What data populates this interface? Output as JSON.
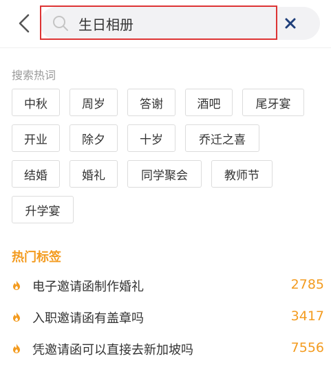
{
  "search": {
    "value": "生日相册",
    "placeholder": ""
  },
  "hot_words": {
    "label": "搜索热词",
    "rows": [
      [
        "中秋",
        "周岁",
        "答谢",
        "酒吧",
        "尾牙宴"
      ],
      [
        "开业",
        "除夕",
        "十岁",
        "乔迁之喜"
      ],
      [
        "结婚",
        "婚礼",
        "同学聚会",
        "教师节"
      ],
      [
        "升学宴"
      ]
    ]
  },
  "hot_tags": {
    "title": "热门标签",
    "items": [
      {
        "text": "电子邀请函制作婚礼",
        "count": "2785"
      },
      {
        "text": "入职邀请函有盖章吗",
        "count": "3417"
      },
      {
        "text": "凭邀请函可以直接去新加坡吗",
        "count": "7556"
      }
    ]
  },
  "colors": {
    "accent": "#f39b1f",
    "highlight_border": "#dd3333",
    "clear_icon": "#1f3f7a"
  },
  "icons": {
    "back": "chevron-left-icon",
    "search": "search-icon",
    "clear": "close-icon",
    "hot": "flame-icon"
  }
}
